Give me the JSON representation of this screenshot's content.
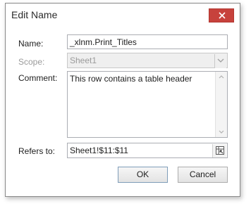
{
  "dialog": {
    "title": "Edit Name",
    "close_icon": "close-icon"
  },
  "form": {
    "name_label": "Name:",
    "name_value": "_xlnm.Print_Titles",
    "scope_label": "Scope:",
    "scope_value": "Sheet1",
    "comment_label": "Comment:",
    "comment_value": "This row contains a table header",
    "refers_label": "Refers to:",
    "refers_value": "Sheet1!$11:$11"
  },
  "buttons": {
    "ok_label": "OK",
    "cancel_label": "Cancel"
  },
  "colors": {
    "close_button": "#c7423c",
    "border": "#abadb3",
    "disabled_text": "#9a9a9a"
  }
}
